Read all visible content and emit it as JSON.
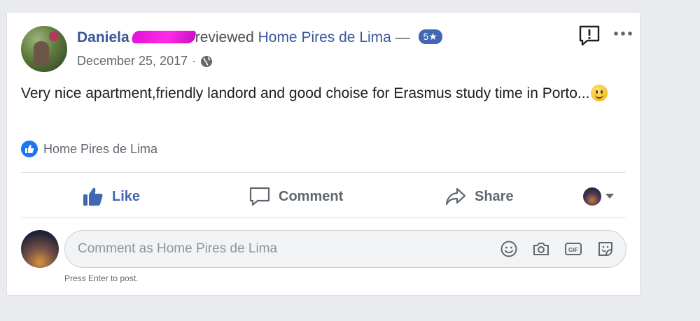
{
  "post": {
    "author": "Daniela",
    "action_text": "reviewed",
    "page_name": "Home Pires de Lima",
    "dash": "—",
    "rating": "5★",
    "date": "December 25, 2017",
    "meta_sep": "·",
    "privacy_icon": "globe-icon",
    "body_text": "Very nice apartment,friendly landord and good choise for Erasmus study time in Porto...",
    "emoji": "smile-emoji"
  },
  "reactions": {
    "names": "Home Pires de Lima",
    "icon": "thumbs-up-icon"
  },
  "actions": {
    "like_label": "Like",
    "comment_label": "Comment",
    "share_label": "Share"
  },
  "composer": {
    "placeholder": "Comment as Home Pires de Lima",
    "hint": "Press Enter to post."
  },
  "colors": {
    "link_blue": "#385898",
    "like_blue": "#4267b2",
    "rating_badge": "#4267b2",
    "redaction_magenta": "#ff2be8"
  }
}
